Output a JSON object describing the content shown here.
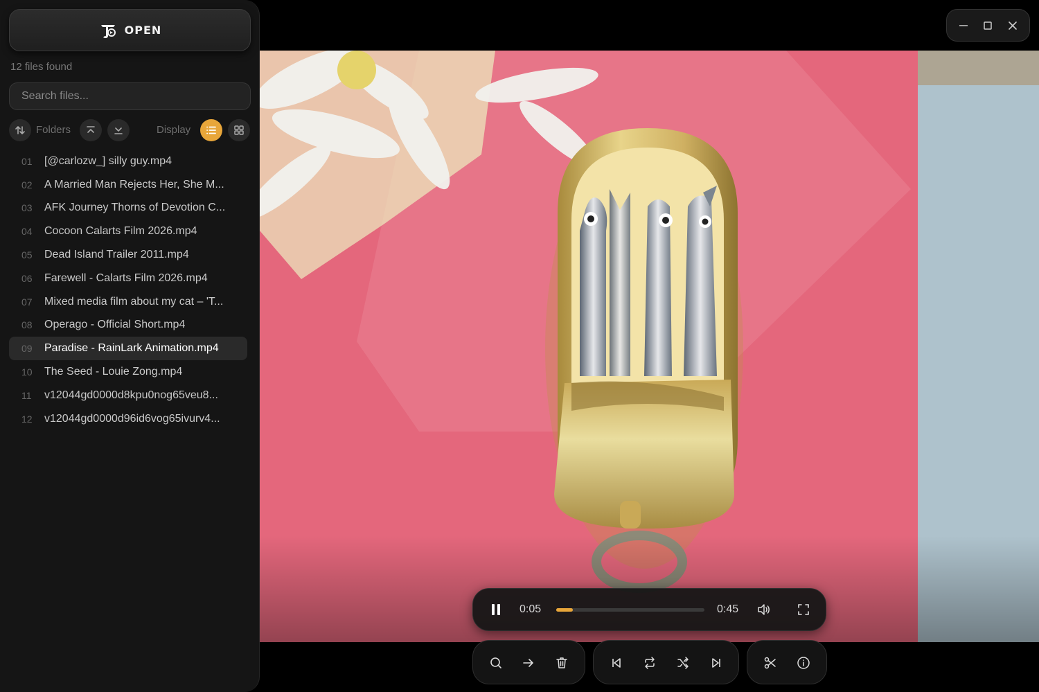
{
  "sidebar": {
    "open_label": "OPEN",
    "files_found": "12 files found",
    "search_placeholder": "Search files...",
    "folders_label": "Folders",
    "display_label": "Display",
    "files": [
      {
        "num": "01",
        "name": "[@carlozw_] silly guy.mp4"
      },
      {
        "num": "02",
        "name": "A Married Man Rejects Her, She M..."
      },
      {
        "num": "03",
        "name": "AFK Journey Thorns of Devotion C..."
      },
      {
        "num": "04",
        "name": "Cocoon Calarts Film 2026.mp4"
      },
      {
        "num": "05",
        "name": "Dead Island Trailer 2011.mp4"
      },
      {
        "num": "06",
        "name": "Farewell - Calarts Film 2026.mp4"
      },
      {
        "num": "07",
        "name": "Mixed media film about my cat – 'T..."
      },
      {
        "num": "08",
        "name": "Operago - Official Short.mp4"
      },
      {
        "num": "09",
        "name": "Paradise - RainLark Animation.mp4"
      },
      {
        "num": "10",
        "name": "The Seed - Louie Zong.mp4"
      },
      {
        "num": "11",
        "name": "v12044gd0000d8kpu0nog65veu8..."
      },
      {
        "num": "12",
        "name": "v12044gd0000d96id6vog65ivurv4..."
      }
    ],
    "selected_index": 8
  },
  "player": {
    "current_time": "0:05",
    "duration": "0:45",
    "progress_fraction": 0.111
  },
  "colors": {
    "accent": "#e8a63a",
    "video_background": "#e4677c"
  },
  "icons": {
    "sort": "sort-icon",
    "collapse_all": "collapse-all-icon",
    "expand_all": "expand-all-icon",
    "list_view": "list-view-icon",
    "grid_view": "grid-view-icon",
    "pause": "pause-icon",
    "volume": "volume-icon",
    "fullscreen": "fullscreen-icon",
    "search": "search-icon",
    "move": "arrow-right-icon",
    "delete": "trash-icon",
    "previous": "skip-previous-icon",
    "repeat": "repeat-icon",
    "shuffle": "shuffle-icon",
    "next": "skip-next-icon",
    "cut": "scissors-icon",
    "info": "info-icon"
  }
}
